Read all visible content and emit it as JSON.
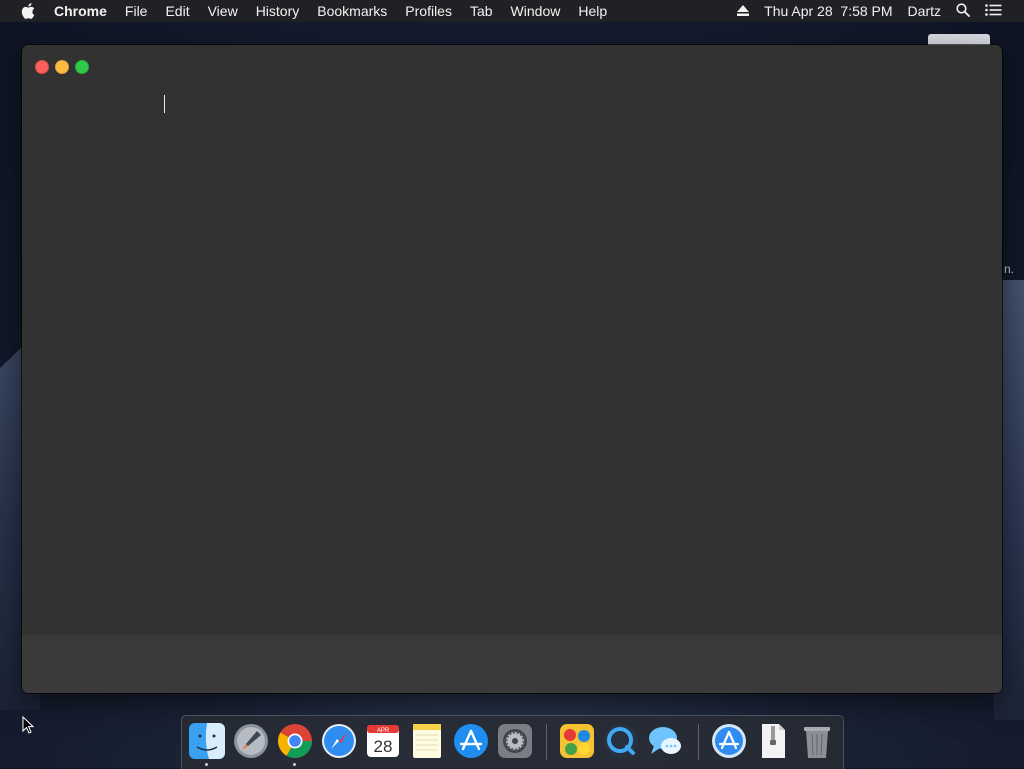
{
  "menubar": {
    "app_name": "Chrome",
    "items": [
      "File",
      "Edit",
      "View",
      "History",
      "Bookmarks",
      "Profiles",
      "Tab",
      "Window",
      "Help"
    ],
    "datetime": "Thu Apr 28  7:58 PM",
    "user": "Dartz"
  },
  "desktop": {
    "partial_text": "n."
  },
  "window": {
    "traffic_lights": [
      "close",
      "minimize",
      "maximize"
    ]
  },
  "dock": {
    "apps": [
      {
        "name": "Finder",
        "icon": "finder-icon",
        "running": true
      },
      {
        "name": "Launchpad",
        "icon": "launchpad-icon",
        "running": false
      },
      {
        "name": "Google Chrome",
        "icon": "chrome-icon",
        "running": true
      },
      {
        "name": "Safari",
        "icon": "safari-icon",
        "running": false
      },
      {
        "name": "Calendar",
        "icon": "calendar-icon",
        "running": false,
        "month": "APR",
        "day": "28"
      },
      {
        "name": "Notes",
        "icon": "notes-icon",
        "running": false
      },
      {
        "name": "App Store",
        "icon": "app-store-icon",
        "running": false
      },
      {
        "name": "System Preferences",
        "icon": "system-preferences-icon",
        "running": false
      },
      {
        "name": "Game",
        "icon": "game-icon",
        "running": false
      },
      {
        "name": "QuickTime Player",
        "icon": "quicktime-icon",
        "running": false
      },
      {
        "name": "Messages",
        "icon": "messages-icon",
        "running": false
      }
    ],
    "files": [
      {
        "name": "Applications",
        "icon": "applications-folder-icon"
      },
      {
        "name": "Downloads",
        "icon": "zip-file-icon"
      },
      {
        "name": "Trash",
        "icon": "trash-icon"
      }
    ]
  },
  "colors": {
    "window_bg": "#323232",
    "menubar_bg": "#202124",
    "close": "#fc605c",
    "minimize": "#fdbc40",
    "maximize": "#34c84a"
  }
}
